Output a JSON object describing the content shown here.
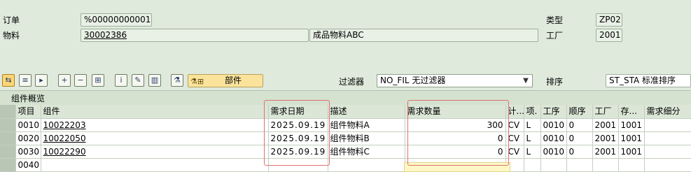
{
  "header": {
    "order_label": "订单",
    "order_value": "%00000000001",
    "material_label": "物料",
    "material_value": "30002386",
    "material_desc": "成品物料ABC",
    "type_label": "类型",
    "type_value": "ZP02",
    "plant_label": "工厂",
    "plant_value": "2001"
  },
  "toolbar": {
    "parts_button": "部件",
    "filter_label": "过滤器",
    "filter_value": "NO_FIL 无过滤器",
    "sort_label": "排序",
    "sort_value": "ST_STA 标准排序"
  },
  "panel": {
    "title": "组件概览"
  },
  "grid": {
    "columns": [
      "项目",
      "组件",
      "需求日期",
      "描述",
      "需求数量",
      "计...",
      "项.",
      "工序",
      "顺序",
      "工厂",
      "存...",
      "需求细分"
    ],
    "rows": [
      [
        "0010",
        "10022203",
        "2025.09.19",
        "组件物料A",
        "300",
        "CV",
        "L",
        "0010",
        "0",
        "2001",
        "1001",
        ""
      ],
      [
        "0020",
        "10022050",
        "2025.09.19",
        "组件物料B",
        "0",
        "CV",
        "L",
        "0010",
        "0",
        "2001",
        "1001",
        ""
      ],
      [
        "0030",
        "10022290",
        "2025.09.19",
        "组件物料C",
        "0",
        "CV",
        "L",
        "0010",
        "0",
        "2001",
        "1001",
        ""
      ]
    ],
    "partial_row_item": "0040"
  },
  "colors": {
    "background": "#dfeadc",
    "highlight_box": "#e07070",
    "button_yellow": "#fbe39b"
  }
}
